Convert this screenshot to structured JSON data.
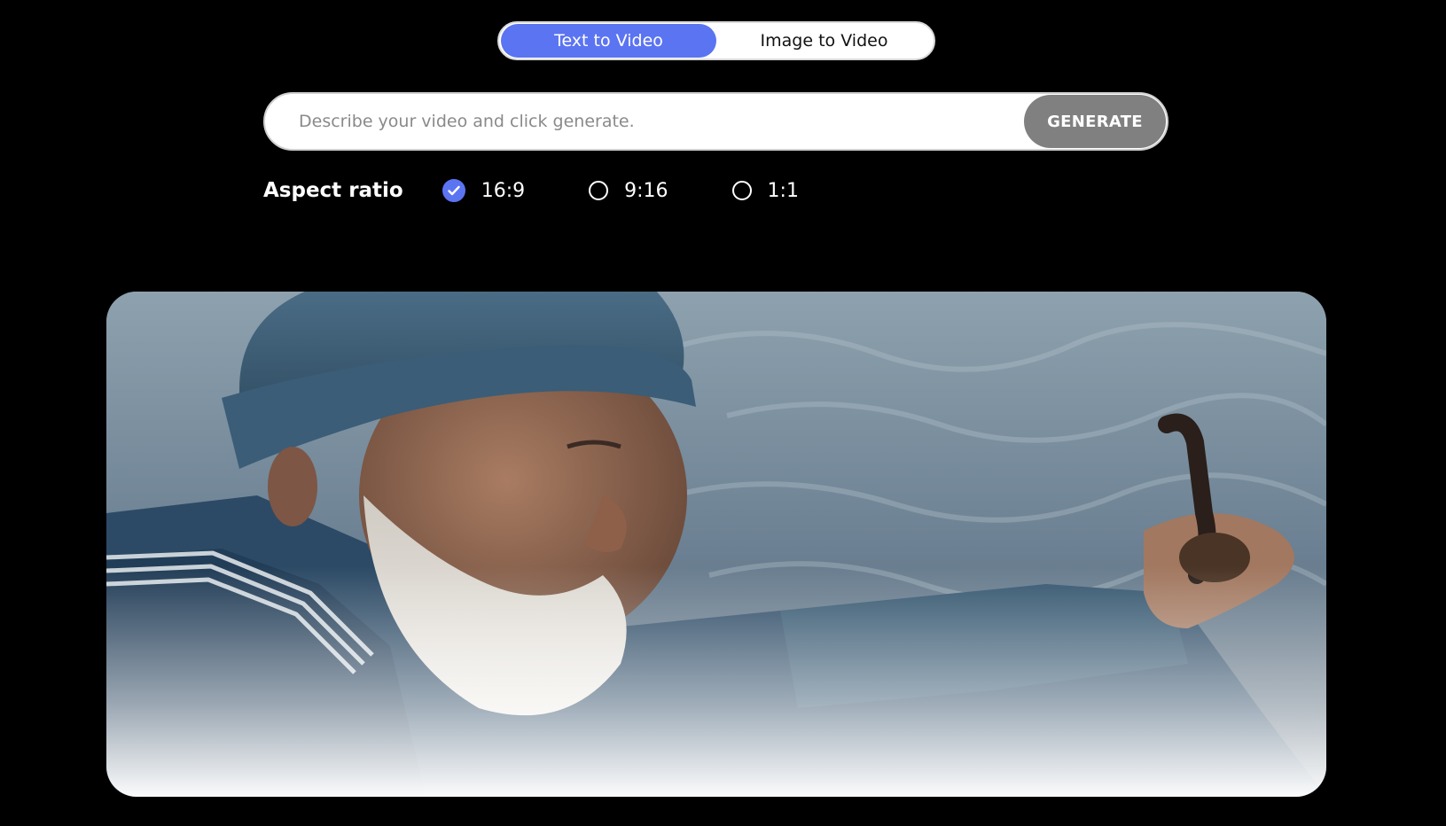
{
  "mode_toggle": {
    "tabs": [
      {
        "label": "Text to Video",
        "active": true
      },
      {
        "label": "Image to Video",
        "active": false
      }
    ]
  },
  "prompt": {
    "placeholder": "Describe your video and click generate.",
    "value": "",
    "generate_label": "GENERATE"
  },
  "aspect_ratio": {
    "label": "Aspect ratio",
    "options": [
      {
        "label": "16:9",
        "selected": true
      },
      {
        "label": "9:16",
        "selected": false
      },
      {
        "label": "1:1",
        "selected": false
      }
    ]
  },
  "preview": {
    "icons": [
      "check-icon"
    ]
  },
  "colors": {
    "accent": "#5b74f2",
    "background": "#000000",
    "generate_button": "#808080"
  }
}
